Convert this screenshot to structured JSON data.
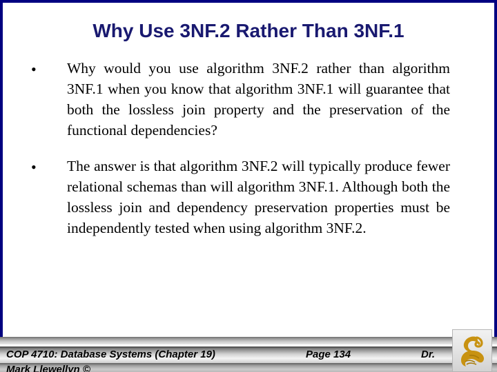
{
  "slide": {
    "title": "Why Use 3NF.2 Rather Than 3NF.1",
    "bullet_marker": "•",
    "bullets": [
      "Why would you use algorithm 3NF.2 rather than algorithm 3NF.1 when you know that algorithm 3NF.1 will guarantee that both the lossless join property and the preservation of the functional dependencies?",
      "The answer is that algorithm 3NF.2 will typically produce fewer relational schemas than will algorithm 3NF.1. Although both the lossless join and dependency preservation properties must be independently tested when using algorithm 3NF.2."
    ]
  },
  "footer": {
    "course": "COP 4710: Database Systems  (Chapter 19)",
    "page": "Page 134",
    "author_prefix": "Dr.",
    "author_name": "Mark Llewellyn ©"
  },
  "colors": {
    "title": "#191970",
    "frame_border": "#000080",
    "body_text": "#000000",
    "logo_gold": "#C89211",
    "logo_gold_dark": "#A87A08",
    "background": "#FFFFFF"
  },
  "logo": {
    "name": "ucf-pegasus-logo",
    "alt": "Pegasus"
  }
}
